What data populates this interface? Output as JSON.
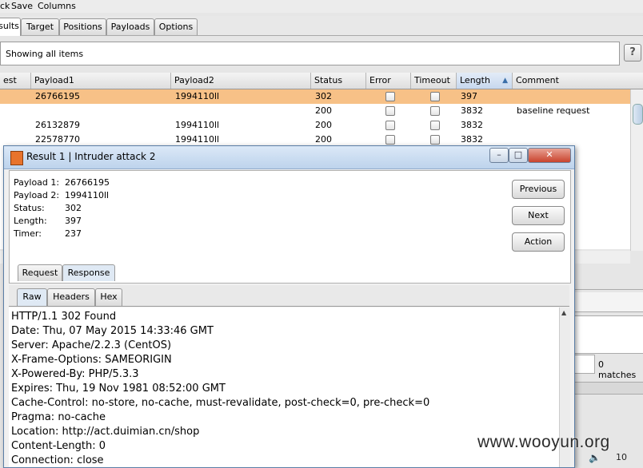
{
  "menu": {
    "items": [
      "ck",
      "Save",
      "Columns"
    ]
  },
  "tabs": [
    "sults",
    "Target",
    "Positions",
    "Payloads",
    "Options"
  ],
  "filter": {
    "text": "Showing all items",
    "help": "?"
  },
  "table": {
    "columns": [
      "est",
      "Payload1",
      "Payload2",
      "Status",
      "Error",
      "Timeout",
      "Length",
      "Comment"
    ],
    "sorted_column": "Length",
    "rows": [
      {
        "payload1": "26766195",
        "payload2": "1994110ll",
        "status": "302",
        "length": "397",
        "comment": "",
        "selected": true,
        "checkboxes": true
      },
      {
        "payload1": "",
        "payload2": "",
        "status": "200",
        "length": "3832",
        "comment": "baseline request",
        "selected": false,
        "checkboxes": true
      },
      {
        "payload1": "26132879",
        "payload2": "1994110ll",
        "status": "200",
        "length": "3832",
        "comment": "",
        "selected": false,
        "checkboxes": true
      },
      {
        "payload1": "22578770",
        "payload2": "1994110ll",
        "status": "200",
        "length": "3832",
        "comment": "",
        "selected": false,
        "checkboxes": true
      }
    ]
  },
  "matches": "0 matches",
  "dialog": {
    "title": "Result 1 | Intruder attack 2",
    "window_buttons": [
      "–",
      "□",
      "✕"
    ],
    "fields": [
      {
        "label": "Payload 1:",
        "value": "26766195"
      },
      {
        "label": "Payload 2:",
        "value": "1994110ll"
      },
      {
        "label": "Status:",
        "value": "302"
      },
      {
        "label": "Length:",
        "value": "397"
      },
      {
        "label": "Timer:",
        "value": "237"
      }
    ],
    "buttons": [
      "Previous",
      "Next",
      "Action"
    ],
    "tabs": [
      "Request",
      "Response"
    ],
    "active_tab": "Response",
    "view_tabs": [
      "Raw",
      "Headers",
      "Hex"
    ],
    "active_view": "Raw",
    "response_lines": [
      "HTTP/1.1 302 Found",
      "Date: Thu, 07 May 2015 14:33:46 GMT",
      "Server: Apache/2.2.3 (CentOS)",
      "X-Frame-Options: SAMEORIGIN",
      "X-Powered-By: PHP/5.3.3",
      "Expires: Thu, 19 Nov 1981 08:52:00 GMT",
      "Cache-Control: no-store, no-cache, must-revalidate, post-check=0, pre-check=0",
      "Pragma: no-cache",
      "Location: http://act.duimian.cn/shop",
      "Content-Length: 0",
      "Connection: close"
    ]
  },
  "watermark": "www.wooyun.org",
  "zoom_text": "10"
}
